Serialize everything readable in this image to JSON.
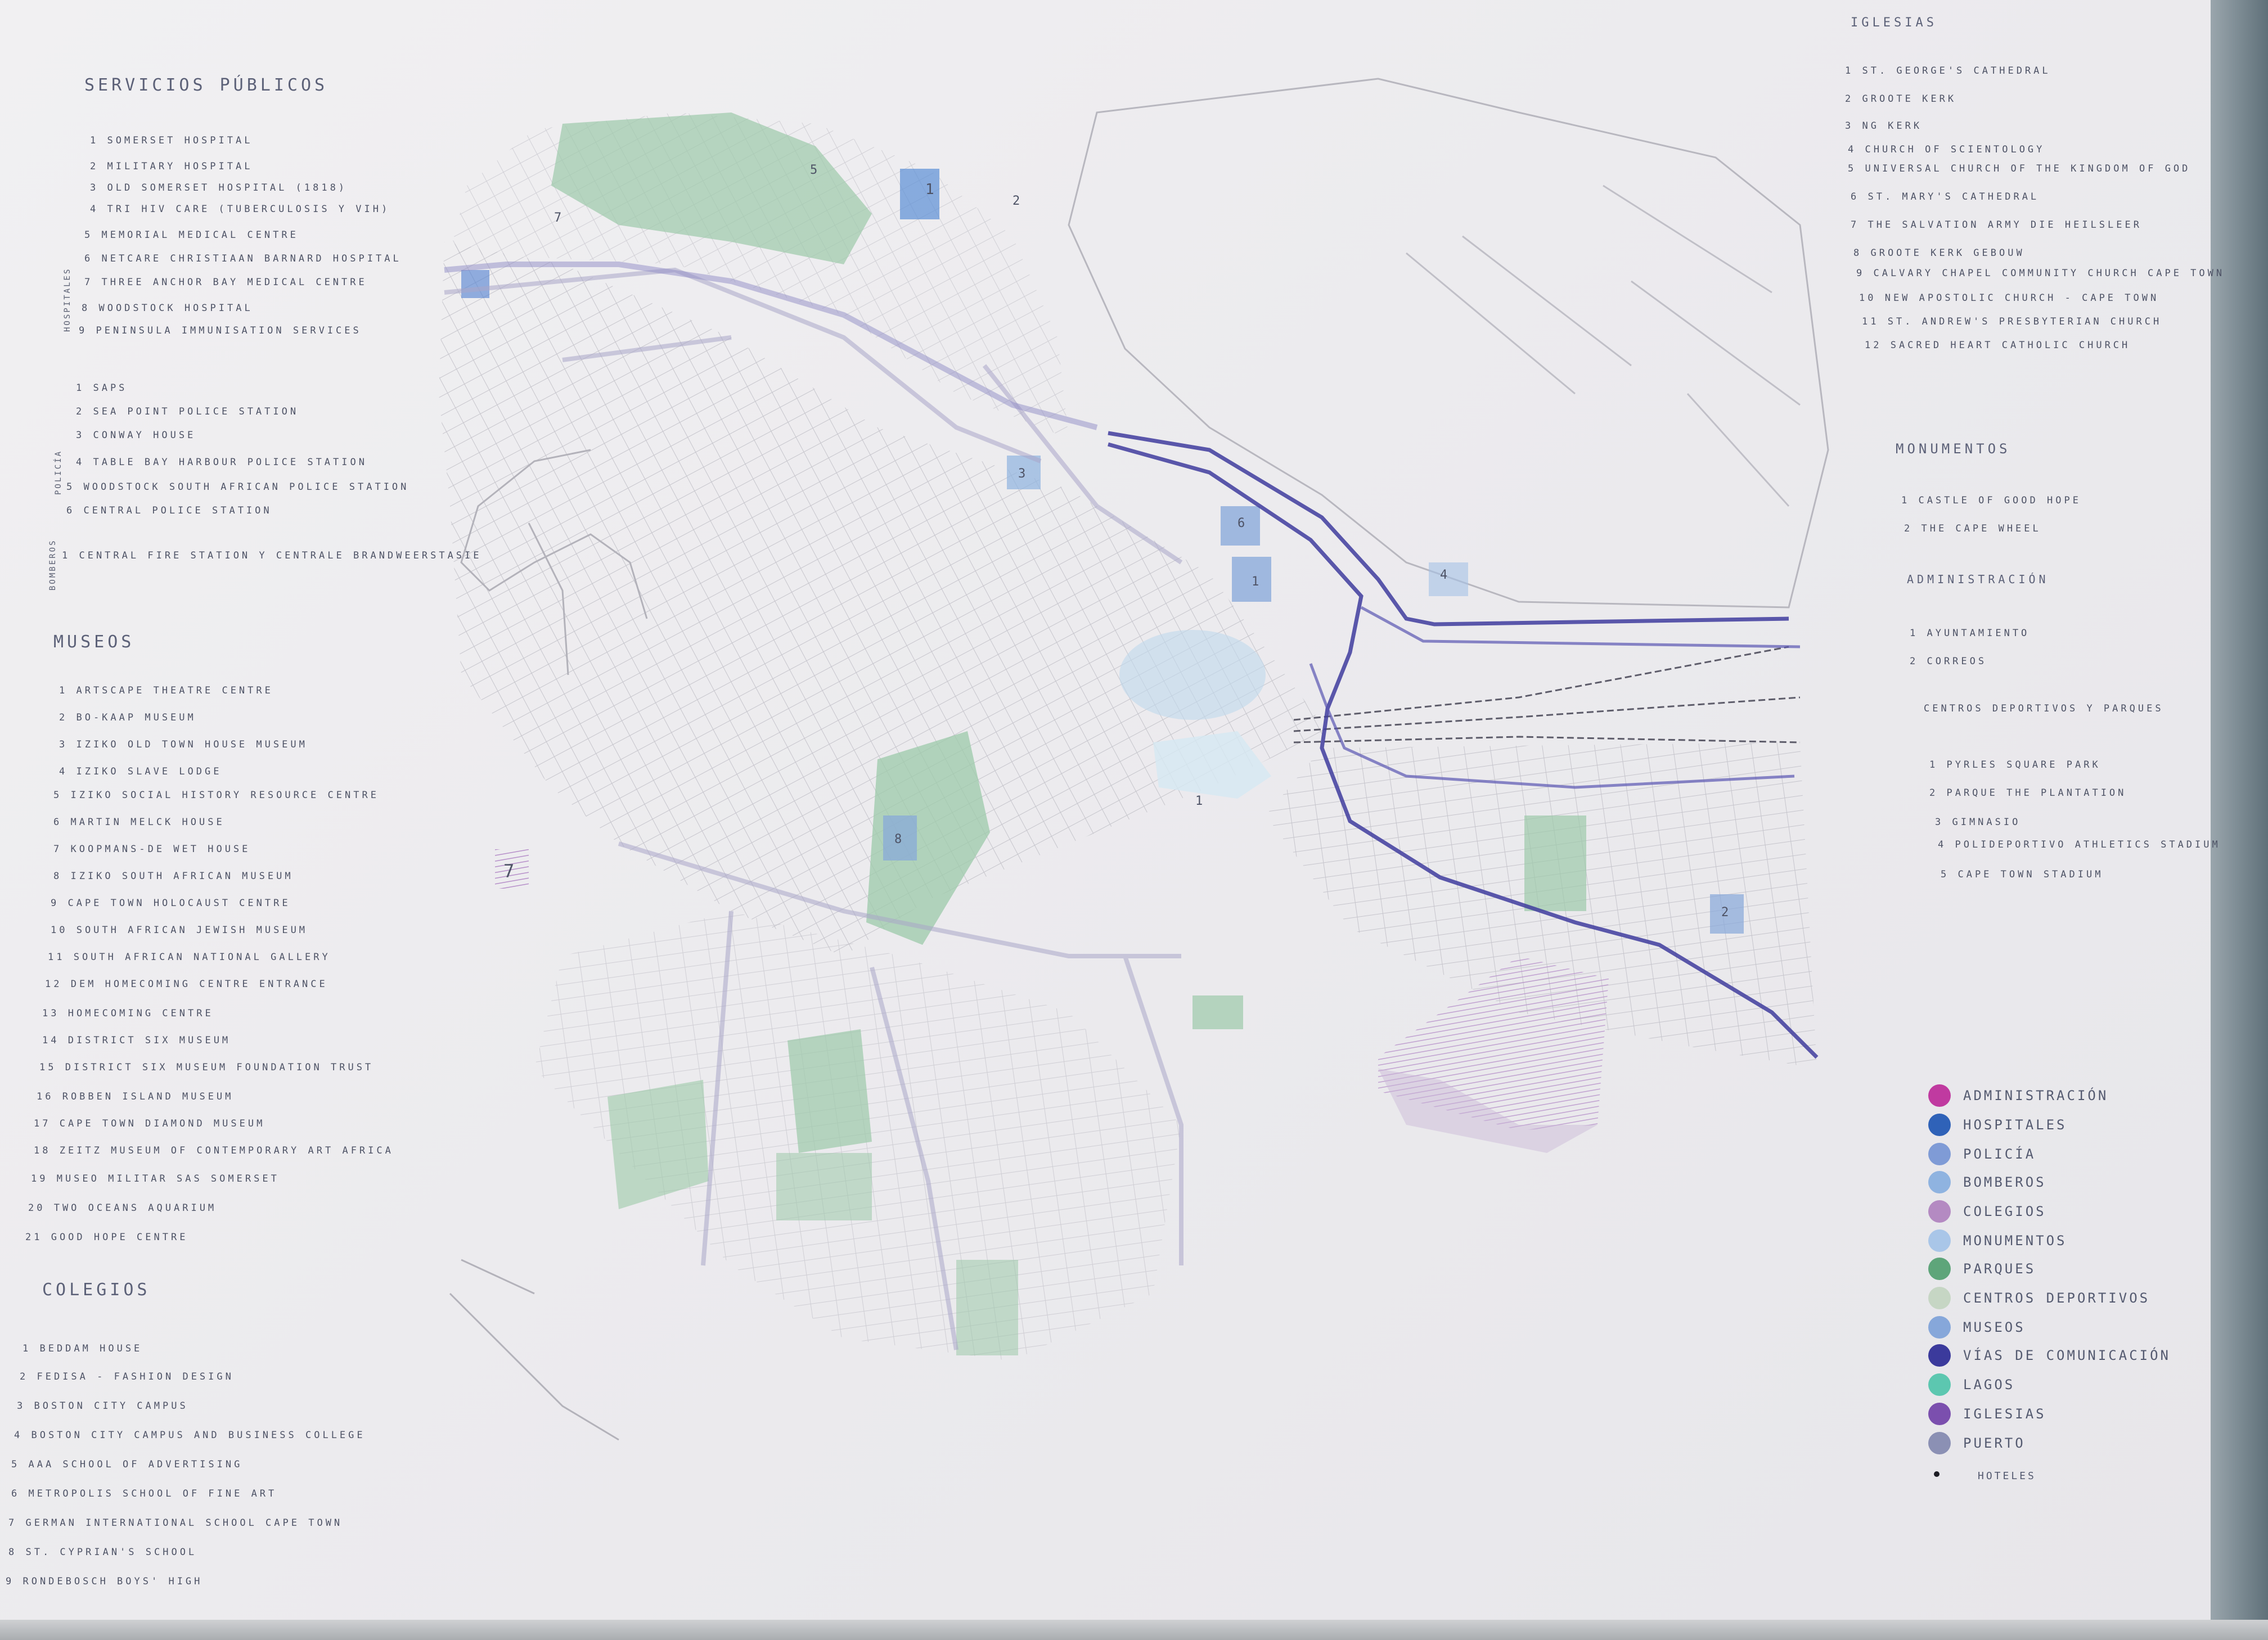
{
  "sections": {
    "servicios_publicos": {
      "title": "SERVICIOS PÚBLICOS",
      "hospitales_label": "HOSPITALES",
      "hospitales": [
        "1 SOMERSET HOSPITAL",
        "2 MILITARY HOSPITAL",
        "3 OLD SOMERSET HOSPITAL (1818)",
        "4 TRI HIV CARE (TUBERCULOSIS Y VIH)",
        "5 MEMORIAL MEDICAL CENTRE",
        "6 NETCARE CHRISTIAAN BARNARD HOSPITAL",
        "7 THREE ANCHOR BAY MEDICAL CENTRE",
        "8 WOODSTOCK HOSPITAL",
        "9 PENINSULA IMMUNISATION SERVICES"
      ],
      "policia_label": "POLICÍA",
      "policia": [
        "1 SAPS",
        "2 SEA POINT POLICE STATION",
        "3 CONWAY HOUSE",
        "4 TABLE BAY HARBOUR POLICE STATION",
        "5 WOODSTOCK SOUTH AFRICAN POLICE STATION",
        "6 CENTRAL POLICE STATION"
      ],
      "bomberos_label": "BOMBEROS",
      "bomberos": [
        "1 CENTRAL FIRE STATION Y CENTRALE BRANDWEERSTASIE"
      ]
    },
    "museos": {
      "title": "MUSEOS",
      "items": [
        "1 ARTSCAPE THEATRE CENTRE",
        "2 BO-KAAP MUSEUM",
        "3 IZIKO OLD TOWN HOUSE MUSEUM",
        "4 IZIKO SLAVE LODGE",
        "5 IZIKO SOCIAL HISTORY RESOURCE CENTRE",
        "6 MARTIN MELCK HOUSE",
        "7 KOOPMANS-DE WET HOUSE",
        "8 IZIKO SOUTH AFRICAN MUSEUM",
        "9 CAPE TOWN HOLOCAUST CENTRE",
        "10 SOUTH AFRICAN JEWISH MUSEUM",
        "11 SOUTH AFRICAN NATIONAL GALLERY",
        "12 DEM HOMECOMING CENTRE ENTRANCE",
        "13 HOMECOMING CENTRE",
        "14 DISTRICT SIX MUSEUM",
        "15 DISTRICT SIX MUSEUM FOUNDATION TRUST",
        "16 ROBBEN ISLAND MUSEUM",
        "17 CAPE TOWN DIAMOND MUSEUM",
        "18 ZEITZ MUSEUM OF CONTEMPORARY ART AFRICA",
        "19 MUSEO MILITAR SAS SOMERSET",
        "20 TWO OCEANS AQUARIUM",
        "21 GOOD HOPE CENTRE"
      ]
    },
    "colegios": {
      "title": "COLEGIOS",
      "items": [
        "1 BEDDAM HOUSE",
        "2 FEDISA - FASHION DESIGN",
        "3 BOSTON CITY CAMPUS",
        "4 BOSTON CITY CAMPUS AND BUSINESS COLLEGE",
        "5 AAA SCHOOL OF ADVERTISING",
        "6 METROPOLIS SCHOOL OF FINE ART",
        "7 GERMAN INTERNATIONAL SCHOOL CAPE TOWN",
        "8 ST. CYPRIAN'S SCHOOL",
        "9 RONDEBOSCH BOYS' HIGH"
      ]
    },
    "iglesias": {
      "title": "IGLESIAS",
      "items": [
        "1 ST. GEORGE'S CATHEDRAL",
        "2 GROOTE KERK",
        "3 NG KERK",
        "4 CHURCH OF SCIENTOLOGY",
        "5 UNIVERSAL CHURCH OF THE KINGDOM OF GOD",
        "6 ST. MARY'S CATHEDRAL",
        "7 THE SALVATION ARMY DIE HEILSLEER",
        "8 GROOTE KERK GEBOUW",
        "9 CALVARY CHAPEL COMMUNITY CHURCH CAPE TOWN",
        "10 NEW APOSTOLIC CHURCH - CAPE TOWN",
        "11 ST. ANDREW'S PRESBYTERIAN CHURCH",
        "12 SACRED HEART CATHOLIC CHURCH"
      ]
    },
    "monumentos": {
      "title": "MONUMENTOS",
      "items": [
        "1 CASTLE OF GOOD HOPE",
        "2 THE CAPE WHEEL"
      ]
    },
    "administracion": {
      "title": "ADMINISTRACIÓN",
      "items": [
        "1 AYUNTAMIENTO",
        "2 CORREOS"
      ]
    },
    "centros_deportivos": {
      "title": "CENTROS DEPORTIVOS Y PARQUES",
      "items": [
        "1 PYRLES SQUARE PARK",
        "2 PARQUE THE PLANTATION",
        "3 GIMNASIO",
        "4 POLIDEPORTIVO ATHLETICS STADIUM",
        "5 CAPE TOWN STADIUM"
      ]
    }
  },
  "legend": [
    {
      "label": "ADMINISTRACIÓN",
      "color": "#c03aa0"
    },
    {
      "label": "HOSPITALES",
      "color": "#2f62b8"
    },
    {
      "label": "POLICÍA",
      "color": "#7f9bd6"
    },
    {
      "label": "BOMBEROS",
      "color": "#8fb3e0"
    },
    {
      "label": "COLEGIOS",
      "color": "#b48ac2"
    },
    {
      "label": "MONUMENTOS",
      "color": "#a9c6e8"
    },
    {
      "label": "PARQUES",
      "color": "#5ea57a"
    },
    {
      "label": "CENTROS DEPORTIVOS",
      "color": "#c6d6c4"
    },
    {
      "label": "MUSEOS",
      "color": "#86a7da"
    },
    {
      "label": "VÍAS DE COMUNICACIÓN",
      "color": "#3b3a9c"
    },
    {
      "label": "LAGOS",
      "color": "#5cc7b0"
    },
    {
      "label": "IGLESIAS",
      "color": "#7b4fae"
    },
    {
      "label": "PUERTO",
      "color": "#8b90b4"
    },
    {
      "label": "HOTELES",
      "color": "#1d1d24"
    }
  ],
  "map_labels": {
    "hospital_1": "1",
    "hospital_2": "2",
    "hospital_7": "7",
    "parque_5": "5",
    "monumento_1": "1",
    "police_3": "3",
    "museo_6": "6",
    "colegio_7": "7",
    "museo_8": "8",
    "deporte_1": "1",
    "deporte_2": "2",
    "deporte_4": "4"
  },
  "colors": {
    "park": "#9cc9a9",
    "road_main": "#3f3c9e",
    "road_minor": "#a9a6c8",
    "street": "#b9b8c0",
    "zone_purple": "#c9b6d8",
    "monument": "#bfd9ec"
  }
}
